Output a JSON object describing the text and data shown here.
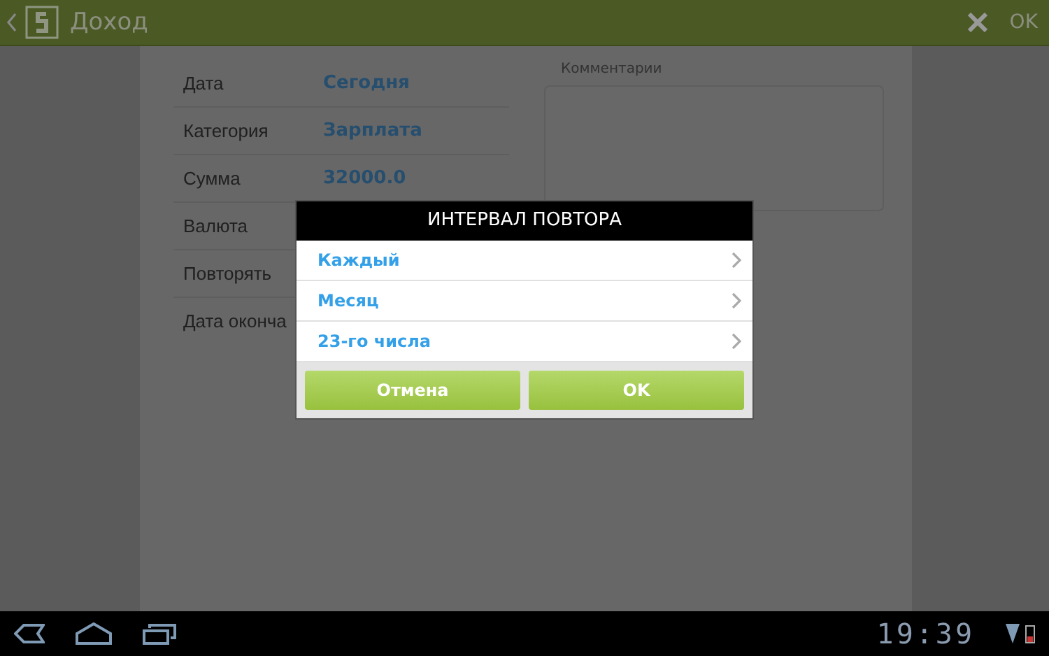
{
  "action_bar": {
    "title": "Доход",
    "confirm": "OK"
  },
  "form": [
    {
      "label": "Дата",
      "value": "Сегодня"
    },
    {
      "label": "Категория",
      "value": "Зарплата"
    },
    {
      "label": "Сумма",
      "value": "32000.0"
    },
    {
      "label": "Валюта"
    },
    {
      "label": "Повторять"
    },
    {
      "label": "Дата оконча"
    }
  ],
  "comments": {
    "label": "Комментарии"
  },
  "dialog": {
    "title": "ИНТЕРВАЛ ПОВТОРА",
    "items": [
      "Каждый",
      "Месяц",
      "23-го числа"
    ],
    "buttons": [
      "Отмена",
      "OK"
    ]
  },
  "status_bar": {
    "time": "19:39"
  }
}
